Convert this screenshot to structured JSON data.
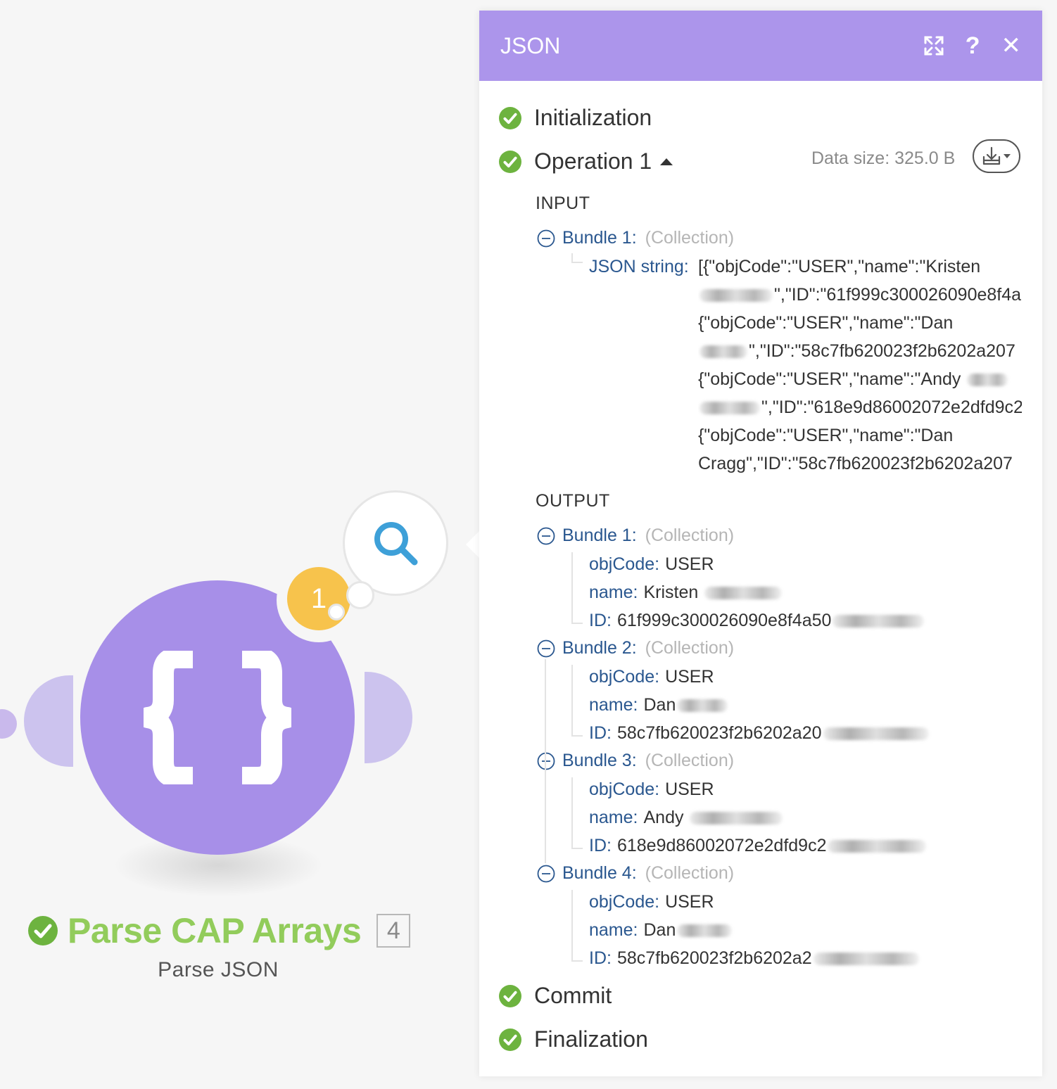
{
  "module": {
    "name": "Parse CAP Arrays",
    "subtitle": "Parse JSON",
    "operations_count": "4",
    "badge": "1"
  },
  "panel": {
    "title": "JSON",
    "phases": {
      "initialization": "Initialization",
      "operation": "Operation 1",
      "commit": "Commit",
      "finalization": "Finalization"
    },
    "data_size": "Data size: 325.0 B",
    "input_label": "INPUT",
    "output_label": "OUTPUT",
    "input_bundle": {
      "label": "Bundle 1:",
      "type": "(Collection)",
      "key": "JSON string:",
      "lines": [
        "[{\"objCode\":\"USER\",\"name\":\"Kristen",
        "\",\"ID\":\"61f999c300026090e8f4a",
        "{\"objCode\":\"USER\",\"name\":\"Dan",
        "\",\"ID\":\"58c7fb620023f2b6202a207",
        "{\"objCode\":\"USER\",\"name\":\"Andy",
        "\",\"ID\":\"618e9d86002072e2dfd9c2",
        "{\"objCode\":\"USER\",\"name\":\"Dan",
        "Cragg\",\"ID\":\"58c7fb620023f2b6202a207"
      ]
    },
    "output_bundles": [
      {
        "label": "Bundle 1:",
        "type": "(Collection)",
        "objcode_key": "objCode:",
        "objcode": "USER",
        "name_key": "name:",
        "name": "Kristen",
        "id_key": "ID:",
        "id": "61f999c300026090e8f4a50"
      },
      {
        "label": "Bundle 2:",
        "type": "(Collection)",
        "objcode_key": "objCode:",
        "objcode": "USER",
        "name_key": "name:",
        "name": "Dan",
        "id_key": "ID:",
        "id": "58c7fb620023f2b6202a20"
      },
      {
        "label": "Bundle 3:",
        "type": "(Collection)",
        "objcode_key": "objCode:",
        "objcode": "USER",
        "name_key": "name:",
        "name": "Andy",
        "id_key": "ID:",
        "id": "618e9d86002072e2dfd9c2"
      },
      {
        "label": "Bundle 4:",
        "type": "(Collection)",
        "objcode_key": "objCode:",
        "objcode": "USER",
        "name_key": "name:",
        "name": "Dan",
        "id_key": "ID:",
        "id": "58c7fb620023f2b6202a2"
      }
    ]
  },
  "colors": {
    "module": "#a78fe8",
    "header": "#ac95eb",
    "success": "#6db33f",
    "title_green": "#92cc5b",
    "badge": "#f7c34c",
    "key_blue": "#2a578f"
  },
  "icons": [
    "search-icon",
    "expand-icon",
    "help-icon",
    "close-icon",
    "check-circle-icon",
    "collapse-circle-icon",
    "download-icon",
    "json-braces-icon"
  ]
}
